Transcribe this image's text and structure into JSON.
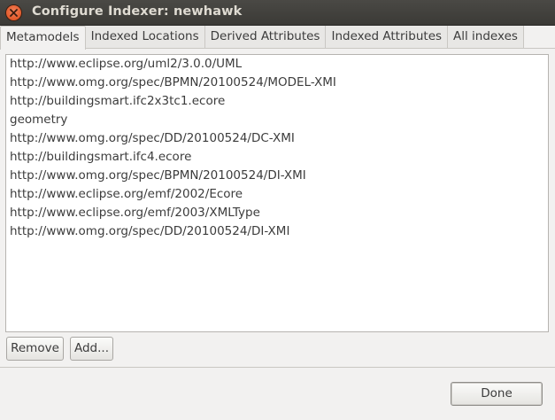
{
  "window": {
    "title": "Configure Indexer: newhawk"
  },
  "tabs": [
    {
      "label": "Metamodels",
      "active": true
    },
    {
      "label": "Indexed Locations",
      "active": false
    },
    {
      "label": "Derived Attributes",
      "active": false
    },
    {
      "label": "Indexed Attributes",
      "active": false
    },
    {
      "label": "All indexes",
      "active": false
    }
  ],
  "metamodels": [
    "http://www.eclipse.org/uml2/3.0.0/UML",
    "http://www.omg.org/spec/BPMN/20100524/MODEL-XMI",
    "http://buildingsmart.ifc2x3tc1.ecore",
    "geometry",
    "http://www.omg.org/spec/DD/20100524/DC-XMI",
    "http://buildingsmart.ifc4.ecore",
    "http://www.omg.org/spec/BPMN/20100524/DI-XMI",
    "http://www.eclipse.org/emf/2002/Ecore",
    "http://www.eclipse.org/emf/2003/XMLType",
    "http://www.omg.org/spec/DD/20100524/DI-XMI"
  ],
  "buttons": {
    "remove": "Remove",
    "add": "Add...",
    "done": "Done"
  },
  "icons": {
    "close": "close-icon"
  },
  "colors": {
    "titlebar": "#3b3a36",
    "close_button": "#e2592a",
    "background": "#f2f1f0"
  }
}
